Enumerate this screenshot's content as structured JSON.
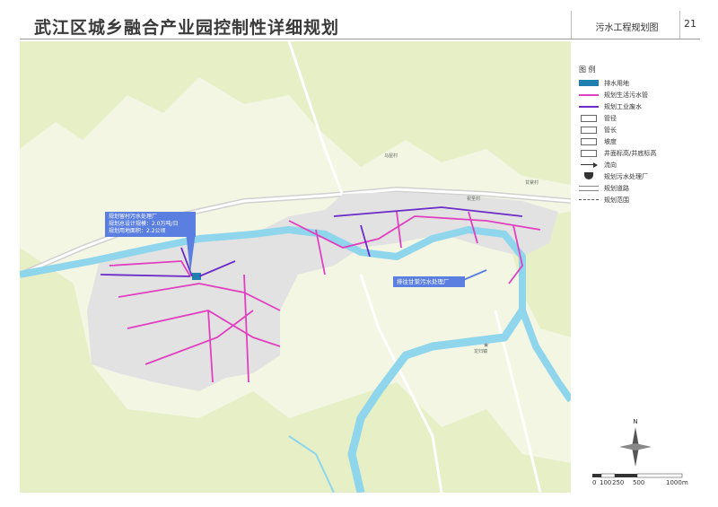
{
  "header": {
    "title": "武江区城乡融合产业园控制性详细规划",
    "subtitle": "污水工程规划图",
    "page_number": "21"
  },
  "legend": {
    "title": "图 例",
    "items": [
      {
        "label": "排水用地",
        "icon": "drainage-land-swatch",
        "color": "#1f7fae"
      },
      {
        "label": "规划生活污水管",
        "icon": "domestic-sewer-line",
        "color": "#e040c0"
      },
      {
        "label": "规划工业废水",
        "icon": "industrial-wastewater-line",
        "color": "#6a2bc8"
      },
      {
        "label": "管径",
        "icon": "pipe-diameter-symbol"
      },
      {
        "label": "管长",
        "icon": "pipe-length-symbol"
      },
      {
        "label": "坡度",
        "icon": "slope-symbol"
      },
      {
        "label": "井面标高/井底标高",
        "icon": "manhole-elevation-symbol"
      },
      {
        "label": "流向",
        "icon": "flow-arrow-symbol"
      },
      {
        "label": "规划污水处理厂",
        "icon": "wwtp-symbol"
      },
      {
        "label": "规划道路",
        "icon": "planned-road-symbol"
      },
      {
        "label": "规划范围",
        "icon": "planning-boundary-symbol"
      }
    ]
  },
  "callouts": {
    "plant": [
      "规划留村污水处理厂",
      "规划总设计规模：2.0万吨/日",
      "规划用地面积：2.2公顷"
    ],
    "to_plant": "排往甘棠污水处理厂"
  },
  "map_labels": {
    "village_ma": "马屋村",
    "village_xiao": "祝圣村",
    "village_e": "甘棠村",
    "star_town": "龙归镇"
  },
  "north": {
    "label": "N"
  },
  "scale": {
    "labels": [
      "0",
      "100",
      "250",
      "500",
      "1000m"
    ]
  },
  "colors": {
    "hill": "#e8f0c8",
    "valley": "#f4f6e4",
    "river": "#8fd6ec",
    "urban": "#e4e4e4",
    "sewer_domestic": "#e040c0",
    "sewer_industrial": "#6a2bc8",
    "callout": "#5a7fe0"
  }
}
